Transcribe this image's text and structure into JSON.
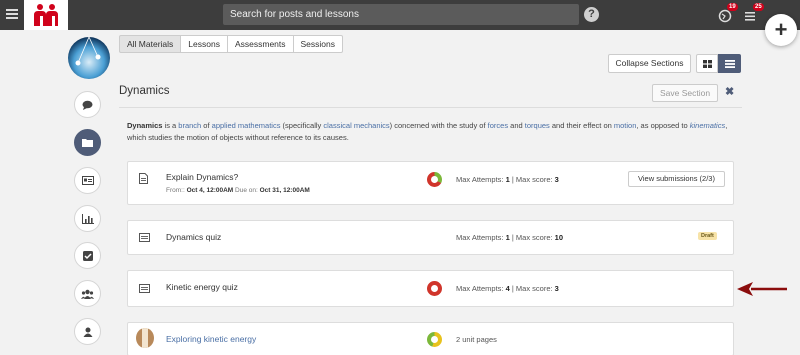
{
  "header": {
    "search_placeholder": "Search for posts and lessons",
    "help_label": "?",
    "notifications_count": "19",
    "messages_count": "25",
    "add_label": "+"
  },
  "tabs": [
    "All Materials",
    "Lessons",
    "Assessments",
    "Sessions"
  ],
  "toolbar": {
    "collapse_label": "Collapse Sections"
  },
  "section": {
    "title": "Dynamics",
    "save_label": "Save Section",
    "close_label": "✖",
    "description": {
      "t1": "Dynamics",
      "t2": " is a ",
      "l1": "branch",
      "t3": " of ",
      "l2": "applied mathematics",
      "t4": " (specifically ",
      "l3": "classical mechanics",
      "t5": ") concerned with the study of ",
      "l4": "forces",
      "t6": " and ",
      "l5": "torques",
      "t7": " and their effect on ",
      "l6": "motion",
      "t8": ", as opposed to ",
      "l7": "kinematics",
      "t9": ", which studies the motion of objects without reference to its causes."
    }
  },
  "items": [
    {
      "title": "Explain Dynamics?",
      "from_label": "From:: ",
      "from_value": "Oct 4, 12:00AM",
      "due_label": "  Due on: ",
      "due_value": "Oct 31, 12:00AM",
      "max_attempts_label": "Max Attempts: ",
      "max_attempts": "1",
      "sep": " | Max score: ",
      "max_score": "3",
      "button": "View submissions (2/3)"
    },
    {
      "title": "Dynamics quiz",
      "max_attempts_label": "Max Attempts: ",
      "max_attempts": "1",
      "sep": " | Max score: ",
      "max_score": "10",
      "badge": "Draft"
    },
    {
      "title": "Kinetic energy quiz",
      "max_attempts_label": "Max Attempts: ",
      "max_attempts": "4",
      "sep": " | Max score: ",
      "max_score": "3"
    },
    {
      "title": "Exploring kinetic energy",
      "pages": "2 unit pages"
    }
  ],
  "colors": {
    "accent": "#4f5c78",
    "link": "#4a6fa5",
    "ring_red": "#d0352b",
    "ring_green": "#7cb83a",
    "ring_yellow": "#e8c21c",
    "arrow": "#8b0d0d"
  }
}
